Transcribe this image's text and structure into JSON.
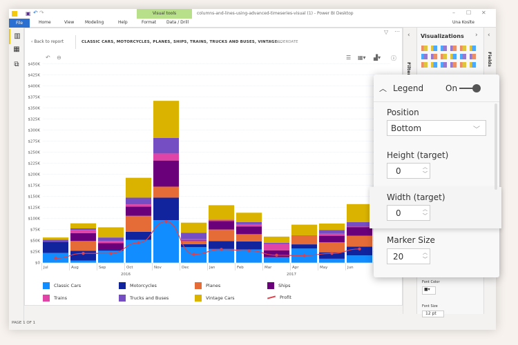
{
  "window": {
    "title": "columns-and-lines-using-advanced-timeseries-visual (1) - Power BI Desktop",
    "user": "Una Koslte",
    "ribbon_context": "Visual tools"
  },
  "ribbon_tabs": [
    "File",
    "Home",
    "View",
    "Modeling",
    "Help",
    "Format",
    "Data / Drill"
  ],
  "header": {
    "back": "Back to report",
    "visual_title": "CLASSIC CARS, MOTORCYCLES, PLANES, SHIPS, TRAINS, TRUCKS AND BUSES, VINTAGE...",
    "by": "BY ORDERDATE"
  },
  "status": "PAGE 1 OF 1",
  "panes": {
    "filters": "Filters",
    "visualizations": "Visualizations",
    "fields": "Fields",
    "font_color": "Font Color",
    "font_size": "Font Size",
    "font_size_value": "12",
    "font_size_unit": "pt"
  },
  "legend_popup": {
    "title": "Legend",
    "toggle_label": "On",
    "toggle_on": true,
    "position_label": "Position",
    "position_value": "Bottom",
    "height_label": "Height (target)",
    "height_value": "0",
    "width_label": "Width (target)",
    "width_value": "0",
    "marker_label": "Marker Size",
    "marker_value": "20"
  },
  "chart_data": {
    "type": "bar",
    "stacked": true,
    "categories": [
      "Jul",
      "Aug",
      "Sep",
      "Oct",
      "Nov",
      "Dec",
      "Jan",
      "Feb",
      "Mar",
      "Apr",
      "May",
      "Jun"
    ],
    "year_labels": [
      {
        "label": "2016",
        "months": [
          "Jul",
          "Aug",
          "Sep",
          "Oct",
          "Nov",
          "Dec"
        ]
      },
      {
        "label": "2017",
        "months": [
          "Jan",
          "Feb",
          "Mar",
          "Apr",
          "May",
          "Jun"
        ]
      }
    ],
    "ylim": [
      0,
      450000
    ],
    "yticks": [
      "$0",
      "$25K",
      "$50K",
      "$75K",
      "$100K",
      "$125K",
      "$150K",
      "$175K",
      "$200K",
      "$225K",
      "$250K",
      "$275K",
      "$300K",
      "$325K",
      "$350K",
      "$375K",
      "$400K",
      "$425K",
      "$450K"
    ],
    "grid": true,
    "legend_position": "bottom",
    "series": [
      {
        "name": "Classic Cars",
        "color": "#118dff",
        "values": [
          22,
          5,
          27,
          51.5,
          96,
          35,
          31,
          30,
          12.5,
          32,
          9,
          16.5
        ]
      },
      {
        "name": "Motorcycles",
        "color": "#12239e",
        "values": [
          25,
          22,
          3,
          18.5,
          51,
          7,
          18,
          18,
          0,
          9.5,
          14.5,
          20
        ]
      },
      {
        "name": "Planes",
        "color": "#e66c37",
        "values": [
          0,
          22,
          0,
          36,
          25,
          7,
          26,
          16.5,
          0,
          20.5,
          22.5,
          24.5
        ]
      },
      {
        "name": "Ships",
        "color": "#6b007b",
        "values": [
          0,
          18,
          14,
          21,
          59,
          1.5,
          19,
          17.5,
          15.5,
          0,
          15,
          19.5
        ]
      },
      {
        "name": "Trains",
        "color": "#e044a7",
        "values": [
          0,
          7,
          5,
          5,
          16,
          2.5,
          3,
          5,
          14.5,
          0,
          4.5,
          1
        ]
      },
      {
        "name": "Trucks and Buses",
        "color": "#744ec2",
        "values": [
          5,
          3.5,
          8,
          15,
          35,
          14.5,
          0,
          5,
          2.5,
          0,
          8.5,
          10.5
        ]
      },
      {
        "name": "Vintage Cars",
        "color": "#d9b300",
        "values": [
          5,
          11.5,
          23,
          45,
          84,
          23,
          33,
          21,
          14,
          24,
          14.5,
          40.5
        ]
      }
    ],
    "line_series": {
      "name": "Profit",
      "color": "#e0404a",
      "values": [
        10,
        21,
        21,
        45,
        93,
        19,
        30,
        27,
        17,
        16,
        21,
        31
      ]
    },
    "value_unit": "thousands of dollars"
  }
}
